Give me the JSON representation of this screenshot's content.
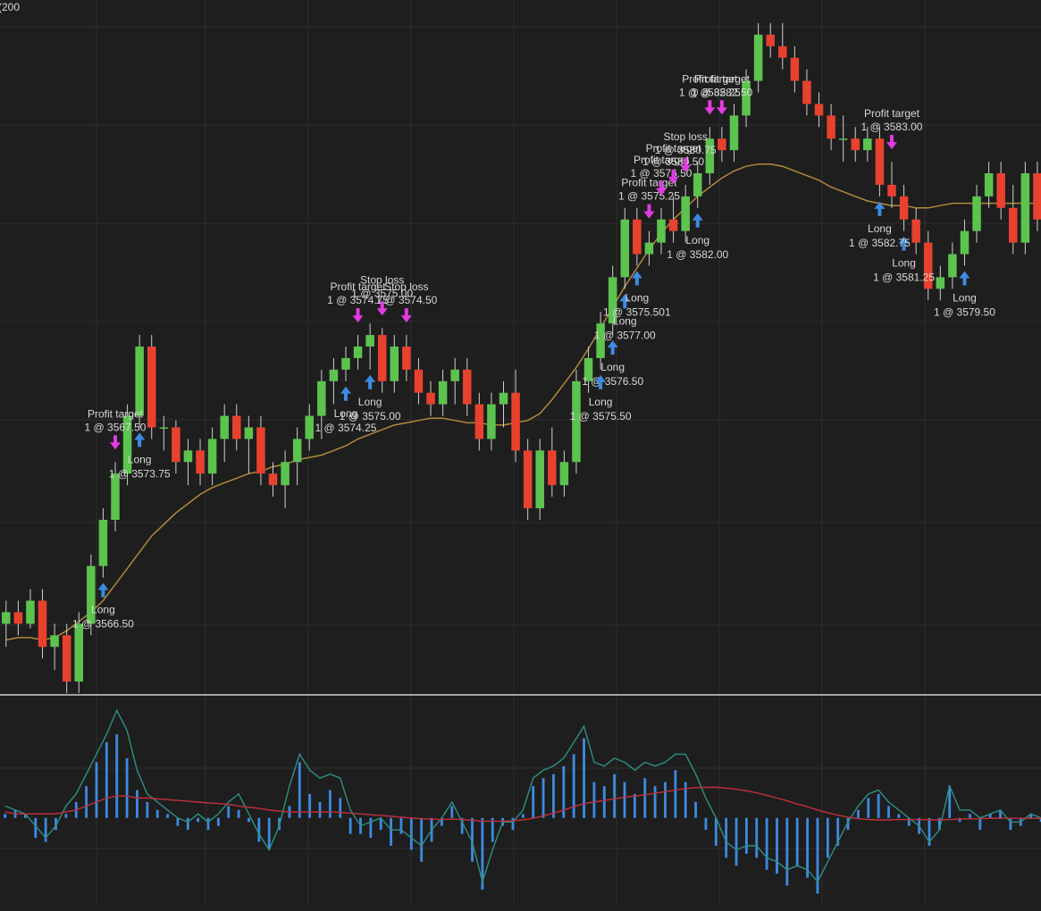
{
  "chart_data": [
    {
      "type": "candlestick",
      "header_fragment": "(200",
      "colors": {
        "background": "#1e1e1e",
        "up": "#5dc34f",
        "down": "#e8412e",
        "ma": "#b08a3a",
        "grid": "#2e2e2e",
        "long_arrow": "#3d8be0",
        "exit_arrow": "#e03ce0",
        "label": "#d8d8d8"
      },
      "ylim": [
        3560.0,
        3590.0
      ],
      "moving_average": [
        3562.3,
        3562.4,
        3562.4,
        3562.3,
        3562.4,
        3562.7,
        3563.1,
        3563.5,
        3564.0,
        3564.7,
        3565.4,
        3566.1,
        3566.8,
        3567.3,
        3567.8,
        3568.2,
        3568.6,
        3568.9,
        3569.1,
        3569.3,
        3569.5,
        3569.6,
        3569.8,
        3569.9,
        3570.1,
        3570.2,
        3570.3,
        3570.5,
        3570.7,
        3571.0,
        3571.2,
        3571.4,
        3571.6,
        3571.7,
        3571.8,
        3571.9,
        3571.9,
        3571.8,
        3571.7,
        3571.7,
        3571.6,
        3571.6,
        3571.7,
        3571.8,
        3572.1,
        3572.7,
        3573.4,
        3574.1,
        3574.9,
        3575.8,
        3576.7,
        3577.6,
        3578.4,
        3579.2,
        3579.9,
        3580.5,
        3581.0,
        3581.5,
        3581.9,
        3582.3,
        3582.6,
        3582.8,
        3582.9,
        3582.9,
        3582.8,
        3582.6,
        3582.4,
        3582.2,
        3581.9,
        3581.7,
        3581.5,
        3581.3,
        3581.2,
        3581.1,
        3581.1,
        3581.0,
        3581.0,
        3581.1,
        3581.2,
        3581.2,
        3581.2,
        3581.2,
        3581.2,
        3581.2,
        3581.2,
        3581.2
      ],
      "candles": [
        {
          "o": 3563.0,
          "h": 3564.0,
          "l": 3562.0,
          "c": 3563.5
        },
        {
          "o": 3563.5,
          "h": 3564.0,
          "l": 3562.5,
          "c": 3563.0
        },
        {
          "o": 3563.0,
          "h": 3564.5,
          "l": 3562.8,
          "c": 3564.0
        },
        {
          "o": 3564.0,
          "h": 3564.5,
          "l": 3561.5,
          "c": 3562.0
        },
        {
          "o": 3562.0,
          "h": 3563.0,
          "l": 3561.0,
          "c": 3562.5
        },
        {
          "o": 3562.5,
          "h": 3563.0,
          "l": 3560.0,
          "c": 3560.5
        },
        {
          "o": 3560.5,
          "h": 3563.5,
          "l": 3560.0,
          "c": 3563.0
        },
        {
          "o": 3563.0,
          "h": 3566.0,
          "l": 3562.5,
          "c": 3565.5
        },
        {
          "o": 3565.5,
          "h": 3568.0,
          "l": 3565.0,
          "c": 3567.5
        },
        {
          "o": 3567.5,
          "h": 3570.0,
          "l": 3567.0,
          "c": 3569.5
        },
        {
          "o": 3569.5,
          "h": 3572.5,
          "l": 3569.0,
          "c": 3572.0
        },
        {
          "o": 3572.0,
          "h": 3575.5,
          "l": 3571.5,
          "c": 3575.0
        },
        {
          "o": 3575.0,
          "h": 3575.5,
          "l": 3571.0,
          "c": 3571.5
        },
        {
          "o": 3571.5,
          "h": 3572.0,
          "l": 3570.5,
          "c": 3571.5
        },
        {
          "o": 3571.5,
          "h": 3571.8,
          "l": 3569.5,
          "c": 3570.0
        },
        {
          "o": 3570.0,
          "h": 3571.0,
          "l": 3569.0,
          "c": 3570.5
        },
        {
          "o": 3570.5,
          "h": 3571.0,
          "l": 3569.0,
          "c": 3569.5
        },
        {
          "o": 3569.5,
          "h": 3571.5,
          "l": 3569.0,
          "c": 3571.0
        },
        {
          "o": 3571.0,
          "h": 3572.5,
          "l": 3570.0,
          "c": 3572.0
        },
        {
          "o": 3572.0,
          "h": 3572.5,
          "l": 3570.5,
          "c": 3571.0
        },
        {
          "o": 3571.0,
          "h": 3572.0,
          "l": 3569.5,
          "c": 3571.5
        },
        {
          "o": 3571.5,
          "h": 3572.0,
          "l": 3569.0,
          "c": 3569.5
        },
        {
          "o": 3569.5,
          "h": 3570.0,
          "l": 3568.5,
          "c": 3569.0
        },
        {
          "o": 3569.0,
          "h": 3570.5,
          "l": 3568.0,
          "c": 3570.0
        },
        {
          "o": 3570.0,
          "h": 3571.5,
          "l": 3569.0,
          "c": 3571.0
        },
        {
          "o": 3571.0,
          "h": 3572.5,
          "l": 3570.5,
          "c": 3572.0
        },
        {
          "o": 3572.0,
          "h": 3574.0,
          "l": 3571.0,
          "c": 3573.5
        },
        {
          "o": 3573.5,
          "h": 3574.5,
          "l": 3572.5,
          "c": 3574.0
        },
        {
          "o": 3574.0,
          "h": 3575.0,
          "l": 3573.5,
          "c": 3574.5
        },
        {
          "o": 3574.5,
          "h": 3575.5,
          "l": 3574.0,
          "c": 3575.0
        },
        {
          "o": 3575.0,
          "h": 3576.0,
          "l": 3574.0,
          "c": 3575.5
        },
        {
          "o": 3575.5,
          "h": 3575.8,
          "l": 3573.0,
          "c": 3573.5
        },
        {
          "o": 3573.5,
          "h": 3575.5,
          "l": 3573.0,
          "c": 3575.0
        },
        {
          "o": 3575.0,
          "h": 3575.5,
          "l": 3573.5,
          "c": 3574.0
        },
        {
          "o": 3574.0,
          "h": 3574.5,
          "l": 3572.5,
          "c": 3573.0
        },
        {
          "o": 3573.0,
          "h": 3573.5,
          "l": 3572.0,
          "c": 3572.5
        },
        {
          "o": 3572.5,
          "h": 3574.0,
          "l": 3572.0,
          "c": 3573.5
        },
        {
          "o": 3573.5,
          "h": 3574.5,
          "l": 3572.5,
          "c": 3574.0
        },
        {
          "o": 3574.0,
          "h": 3574.5,
          "l": 3572.0,
          "c": 3572.5
        },
        {
          "o": 3572.5,
          "h": 3573.0,
          "l": 3570.5,
          "c": 3571.0
        },
        {
          "o": 3571.0,
          "h": 3573.0,
          "l": 3570.5,
          "c": 3572.5
        },
        {
          "o": 3572.5,
          "h": 3573.5,
          "l": 3571.5,
          "c": 3573.0
        },
        {
          "o": 3573.0,
          "h": 3574.0,
          "l": 3570.0,
          "c": 3570.5
        },
        {
          "o": 3570.5,
          "h": 3571.0,
          "l": 3567.5,
          "c": 3568.0
        },
        {
          "o": 3568.0,
          "h": 3571.0,
          "l": 3567.5,
          "c": 3570.5
        },
        {
          "o": 3570.5,
          "h": 3571.5,
          "l": 3568.5,
          "c": 3569.0
        },
        {
          "o": 3569.0,
          "h": 3570.5,
          "l": 3568.5,
          "c": 3570.0
        },
        {
          "o": 3570.0,
          "h": 3574.0,
          "l": 3569.5,
          "c": 3573.5
        },
        {
          "o": 3573.5,
          "h": 3575.0,
          "l": 3573.0,
          "c": 3574.5
        },
        {
          "o": 3574.5,
          "h": 3576.5,
          "l": 3574.0,
          "c": 3576.0
        },
        {
          "o": 3576.0,
          "h": 3578.5,
          "l": 3575.5,
          "c": 3578.0
        },
        {
          "o": 3578.0,
          "h": 3581.0,
          "l": 3577.5,
          "c": 3580.5
        },
        {
          "o": 3580.5,
          "h": 3581.0,
          "l": 3578.5,
          "c": 3579.0
        },
        {
          "o": 3579.0,
          "h": 3580.0,
          "l": 3578.5,
          "c": 3579.5
        },
        {
          "o": 3579.5,
          "h": 3581.0,
          "l": 3579.0,
          "c": 3580.5
        },
        {
          "o": 3580.5,
          "h": 3581.5,
          "l": 3579.5,
          "c": 3580.0
        },
        {
          "o": 3580.0,
          "h": 3582.0,
          "l": 3579.5,
          "c": 3581.5
        },
        {
          "o": 3581.5,
          "h": 3583.0,
          "l": 3581.0,
          "c": 3582.5
        },
        {
          "o": 3582.5,
          "h": 3584.5,
          "l": 3582.0,
          "c": 3584.0
        },
        {
          "o": 3584.0,
          "h": 3584.5,
          "l": 3583.0,
          "c": 3583.5
        },
        {
          "o": 3583.5,
          "h": 3585.5,
          "l": 3583.0,
          "c": 3585.0
        },
        {
          "o": 3585.0,
          "h": 3587.0,
          "l": 3584.5,
          "c": 3586.5
        },
        {
          "o": 3586.5,
          "h": 3589.0,
          "l": 3586.0,
          "c": 3588.5
        },
        {
          "o": 3588.5,
          "h": 3589.0,
          "l": 3587.5,
          "c": 3588.0
        },
        {
          "o": 3588.0,
          "h": 3589.0,
          "l": 3587.0,
          "c": 3587.5
        },
        {
          "o": 3587.5,
          "h": 3588.0,
          "l": 3586.0,
          "c": 3586.5
        },
        {
          "o": 3586.5,
          "h": 3587.0,
          "l": 3585.0,
          "c": 3585.5
        },
        {
          "o": 3585.5,
          "h": 3586.0,
          "l": 3584.5,
          "c": 3585.0
        },
        {
          "o": 3585.0,
          "h": 3585.5,
          "l": 3583.5,
          "c": 3584.0
        },
        {
          "o": 3584.0,
          "h": 3585.0,
          "l": 3583.0,
          "c": 3584.0
        },
        {
          "o": 3584.0,
          "h": 3584.5,
          "l": 3583.0,
          "c": 3583.5
        },
        {
          "o": 3583.5,
          "h": 3584.5,
          "l": 3583.0,
          "c": 3584.0
        },
        {
          "o": 3584.0,
          "h": 3584.5,
          "l": 3581.5,
          "c": 3582.0
        },
        {
          "o": 3582.0,
          "h": 3583.0,
          "l": 3581.0,
          "c": 3581.5
        },
        {
          "o": 3581.5,
          "h": 3582.0,
          "l": 3580.0,
          "c": 3580.5
        },
        {
          "o": 3580.5,
          "h": 3581.0,
          "l": 3579.0,
          "c": 3579.5
        },
        {
          "o": 3579.5,
          "h": 3580.0,
          "l": 3577.0,
          "c": 3577.5
        },
        {
          "o": 3577.5,
          "h": 3578.5,
          "l": 3577.0,
          "c": 3578.0
        },
        {
          "o": 3578.0,
          "h": 3579.5,
          "l": 3577.5,
          "c": 3579.0
        },
        {
          "o": 3579.0,
          "h": 3580.5,
          "l": 3578.5,
          "c": 3580.0
        },
        {
          "o": 3580.0,
          "h": 3582.0,
          "l": 3579.5,
          "c": 3581.5
        },
        {
          "o": 3581.5,
          "h": 3583.0,
          "l": 3581.0,
          "c": 3582.5
        },
        {
          "o": 3582.5,
          "h": 3583.0,
          "l": 3580.5,
          "c": 3581.0
        },
        {
          "o": 3581.0,
          "h": 3582.0,
          "l": 3579.0,
          "c": 3579.5
        },
        {
          "o": 3579.5,
          "h": 3583.0,
          "l": 3579.0,
          "c": 3582.5
        },
        {
          "o": 3582.5,
          "h": 3583.0,
          "l": 3580.0,
          "c": 3580.5
        }
      ],
      "trades": [
        {
          "label": "Long",
          "price": "1 @ 3566.50",
          "type": "long"
        },
        {
          "label": "Long",
          "price": "1 @ 3573.75",
          "type": "long"
        },
        {
          "label": "Long",
          "price": "1 @ 3574.25",
          "type": "long"
        },
        {
          "label": "Long",
          "price": "1 @ 3575.00",
          "type": "long"
        },
        {
          "label": "Long",
          "price": "1 @ 3576.50",
          "type": "long"
        },
        {
          "label": "Long",
          "price": "1 @ 3575.50",
          "type": "long"
        },
        {
          "label": "Long",
          "price": "1 @ 3577.00",
          "type": "long"
        },
        {
          "label": "Long",
          "price": "1 @ 3575.501",
          "type": "long"
        },
        {
          "label": "Long",
          "price": "1 @ 3581.25",
          "type": "long"
        },
        {
          "label": "Long",
          "price": "1 @ 3582.75",
          "type": "long"
        },
        {
          "label": "Long",
          "price": "1 @ 3579.50",
          "type": "long"
        },
        {
          "label": "Long",
          "price": "1 @ 3582.00",
          "type": "long"
        },
        {
          "label": "Profit target",
          "price": "1 @ 3567.50",
          "type": "exit"
        },
        {
          "label": "Profit target",
          "price": "1 @ 3575.25",
          "type": "exit"
        },
        {
          "label": "Profit target",
          "price": "1 @ 3574.75",
          "type": "exit"
        },
        {
          "label": "Profit target",
          "price": "1 @ 3576.50",
          "type": "exit"
        },
        {
          "label": "Profit target",
          "price": "1 @ 3582.25",
          "type": "exit"
        },
        {
          "label": "Profit target",
          "price": "1 @ 3580.50",
          "type": "exit"
        },
        {
          "label": "Profit target",
          "price": "1 @ 3582.50",
          "type": "exit"
        },
        {
          "label": "Profit target",
          "price": "1 @ 3583.00",
          "type": "exit"
        },
        {
          "label": "Stop loss",
          "price": "1 @ 3575.00",
          "type": "stop"
        },
        {
          "label": "Stop loss",
          "price": "1 @ 3580.75",
          "type": "stop"
        },
        {
          "label": "Stop loss",
          "price": "1 @ 3574.50",
          "type": "stop"
        }
      ]
    },
    {
      "type": "bar-with-lines",
      "colors": {
        "histogram": "#3d8be0",
        "line_1": "#2e8f86",
        "line_2": "#c2303a"
      },
      "ylim": [
        -2.0,
        3.0
      ],
      "histogram": [
        0.1,
        0.2,
        0.1,
        -0.5,
        -0.6,
        -0.3,
        0.1,
        0.4,
        0.8,
        1.4,
        1.9,
        2.1,
        1.5,
        0.7,
        0.4,
        0.2,
        0.1,
        -0.2,
        -0.3,
        -0.1,
        -0.3,
        -0.2,
        0.3,
        0.2,
        -0.1,
        -0.6,
        -0.8,
        -0.3,
        0.3,
        1.4,
        0.6,
        0.4,
        0.7,
        0.5,
        -0.4,
        -0.4,
        -0.5,
        -0.3,
        -0.7,
        -0.4,
        -0.8,
        -1.1,
        -0.6,
        -0.2,
        0.3,
        -0.4,
        -1.1,
        -1.8,
        -0.6,
        -0.2,
        -0.3,
        0.1,
        0.8,
        1.0,
        1.1,
        1.3,
        1.6,
        2.0,
        0.9,
        0.8,
        1.1,
        0.9,
        0.6,
        1.0,
        0.8,
        0.9,
        1.2,
        0.9,
        0.4,
        -0.3,
        -0.7,
        -1.0,
        -1.2,
        -0.9,
        -1.0,
        -1.3,
        -1.4,
        -1.7,
        -1.2,
        -1.5,
        -1.9,
        -1.0,
        -0.7,
        -0.3,
        0.2,
        0.5,
        0.6,
        0.3,
        0.1,
        -0.2,
        -0.4,
        -0.7,
        -0.3,
        0.8,
        -0.1,
        0.1,
        -0.3,
        0.1,
        0.2,
        -0.3,
        -0.2,
        0.1,
        -0.1
      ],
      "line_1": [
        0.3,
        0.2,
        0.1,
        -0.2,
        -0.5,
        -0.2,
        0.3,
        0.6,
        1.1,
        1.6,
        2.1,
        2.7,
        2.2,
        1.2,
        0.6,
        0.4,
        0.2,
        0.0,
        -0.1,
        0.1,
        -0.1,
        0.1,
        0.4,
        0.6,
        0.1,
        -0.4,
        -0.8,
        -0.2,
        0.8,
        1.6,
        1.2,
        1.0,
        1.1,
        1.0,
        0.2,
        -0.2,
        -0.1,
        0.0,
        -0.3,
        -0.3,
        -0.5,
        -0.7,
        -0.3,
        0.0,
        0.4,
        -0.1,
        -0.6,
        -1.6,
        -0.8,
        -0.1,
        -0.1,
        0.2,
        1.0,
        1.2,
        1.3,
        1.5,
        1.9,
        2.3,
        1.4,
        1.3,
        1.5,
        1.4,
        1.2,
        1.4,
        1.3,
        1.4,
        1.6,
        1.6,
        1.1,
        0.5,
        0.0,
        -0.6,
        -0.8,
        -0.7,
        -0.7,
        -1.0,
        -1.1,
        -1.3,
        -1.2,
        -1.3,
        -1.6,
        -1.1,
        -0.6,
        -0.1,
        0.3,
        0.6,
        0.7,
        0.4,
        0.2,
        0.0,
        -0.2,
        -0.6,
        -0.3,
        0.8,
        0.2,
        0.2,
        0.0,
        0.1,
        0.2,
        -0.1,
        -0.1,
        0.1,
        0.0
      ],
      "line_2": [
        0.15,
        0.1,
        0.1,
        0.1,
        0.1,
        0.1,
        0.15,
        0.2,
        0.3,
        0.4,
        0.5,
        0.55,
        0.55,
        0.5,
        0.5,
        0.48,
        0.46,
        0.44,
        0.42,
        0.4,
        0.38,
        0.36,
        0.34,
        0.3,
        0.27,
        0.24,
        0.2,
        0.17,
        0.15,
        0.15,
        0.15,
        0.15,
        0.15,
        0.14,
        0.12,
        0.1,
        0.08,
        0.06,
        0.04,
        0.02,
        0.0,
        -0.02,
        -0.03,
        -0.04,
        -0.03,
        -0.04,
        -0.06,
        -0.08,
        -0.08,
        -0.08,
        -0.07,
        -0.05,
        -0.01,
        0.05,
        0.12,
        0.2,
        0.28,
        0.36,
        0.4,
        0.44,
        0.48,
        0.52,
        0.55,
        0.58,
        0.62,
        0.66,
        0.7,
        0.74,
        0.76,
        0.77,
        0.77,
        0.75,
        0.72,
        0.68,
        0.63,
        0.57,
        0.5,
        0.43,
        0.35,
        0.28,
        0.2,
        0.13,
        0.07,
        0.02,
        -0.02,
        -0.04,
        -0.05,
        -0.05,
        -0.04,
        -0.04,
        -0.04,
        -0.05,
        -0.05,
        -0.04,
        -0.03,
        -0.02,
        -0.02,
        -0.01,
        -0.01,
        -0.01,
        -0.01,
        -0.01,
        -0.01
      ]
    }
  ]
}
